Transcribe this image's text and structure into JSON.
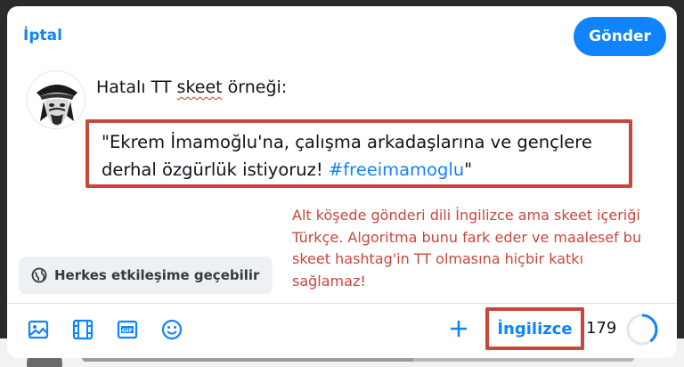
{
  "header": {
    "cancel_label": "İptal",
    "send_label": "Gönder"
  },
  "post": {
    "title_before": "Hatalı TT ",
    "title_misspelled": "skeet",
    "title_after": " örneği:",
    "quote_text": "\"Ekrem İmamoğlu'na, çalışma arkadaşlarına ve gençlere derhal özgürlük istiyoruz! ",
    "hashtag": "#freeimamoglu",
    "quote_end": "\""
  },
  "annotation": {
    "text": "Alt köşede gönderi dili İngilizce ama skeet içeriği Türkçe. Algoritma bunu fark eder ve maalesef bu skeet hashtag'in TT olmasına hiçbir katkı sağlamaz!"
  },
  "reply_setting": {
    "label": "Herkes etkileşime geçebilir",
    "icon": "globe-icon"
  },
  "toolbar": {
    "icons": [
      "image-icon",
      "video-icon",
      "gif-icon",
      "emoji-icon"
    ],
    "add_icon": "plus-icon",
    "language_label": "İngilizce",
    "char_remaining": "179",
    "progress_fraction": 0.4
  },
  "colors": {
    "accent": "#1083fe",
    "annotation_red": "#c8473d"
  }
}
